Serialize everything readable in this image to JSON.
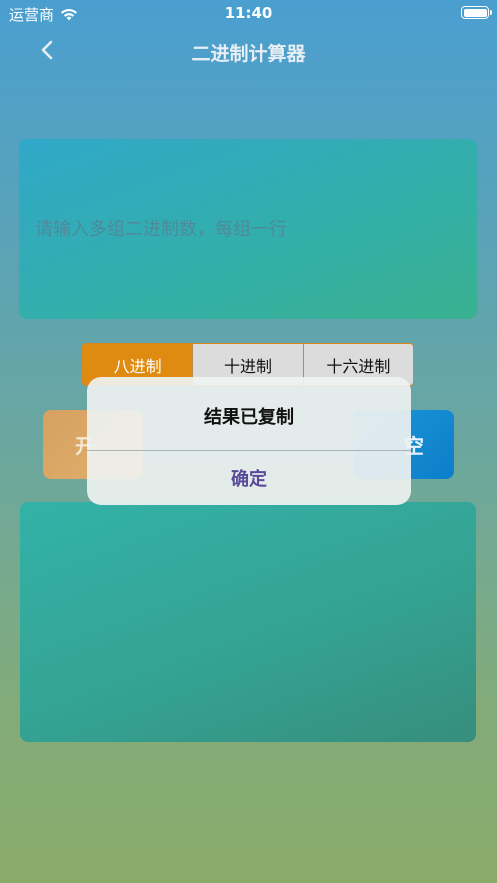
{
  "status_bar": {
    "carrier": "运营商",
    "time": "11:40"
  },
  "nav": {
    "title": "二进制计算器"
  },
  "input": {
    "placeholder": "请输入多组二进制数，每组一行",
    "value": ""
  },
  "segmented": {
    "options": [
      "八进制",
      "十进制",
      "十六进制"
    ],
    "selected": "八进制"
  },
  "buttons": {
    "start_visible": "开",
    "clear_visible": "空"
  },
  "alert": {
    "title": "结果已复制",
    "ok": "确定"
  },
  "colors": {
    "accent": "#df8a10",
    "alert_button": "#5a4a9a",
    "clear_button": "#0b7ec9"
  }
}
